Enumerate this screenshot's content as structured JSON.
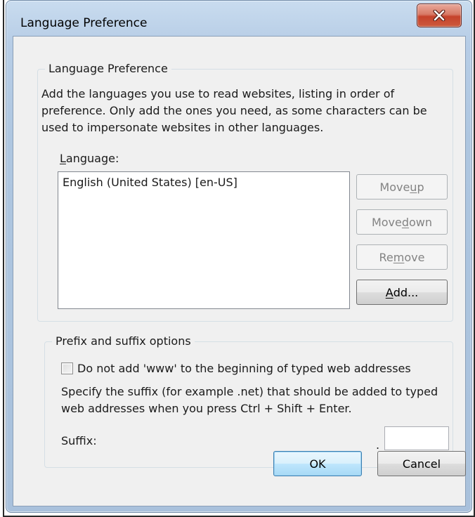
{
  "window": {
    "title": "Language Preference",
    "close_icon": "close-x-icon"
  },
  "language_group": {
    "title": "Language Preference",
    "description": "Add the languages you use to read websites, listing in order of preference. Only add the ones you need, as some characters can be used to impersonate websites in other languages.",
    "language_label": {
      "pre": "",
      "acc": "L",
      "post": "anguage:"
    },
    "languages": [
      "English (United States) [en-US]"
    ],
    "buttons": {
      "move_up": {
        "pre": "Move ",
        "acc": "u",
        "post": "p",
        "enabled": false
      },
      "move_down": {
        "pre": "Move ",
        "acc": "d",
        "post": "own",
        "enabled": false
      },
      "remove": {
        "pre": "Re",
        "acc": "m",
        "post": "ove",
        "enabled": false
      },
      "add": {
        "pre": "",
        "acc": "A",
        "post": "dd...",
        "enabled": true
      }
    }
  },
  "prefix_group": {
    "title": "Prefix and suffix options",
    "checkbox_label": "Do not add 'www' to the beginning of typed web addresses",
    "checkbox_checked": false,
    "suffix_description": "Specify the suffix (for example .net) that should be added to typed web addresses when you press Ctrl + Shift + Enter.",
    "suffix_label": "Suffix:",
    "suffix_dot": ".",
    "suffix_value": ""
  },
  "footer": {
    "ok_label": "OK",
    "cancel_label": "Cancel"
  }
}
